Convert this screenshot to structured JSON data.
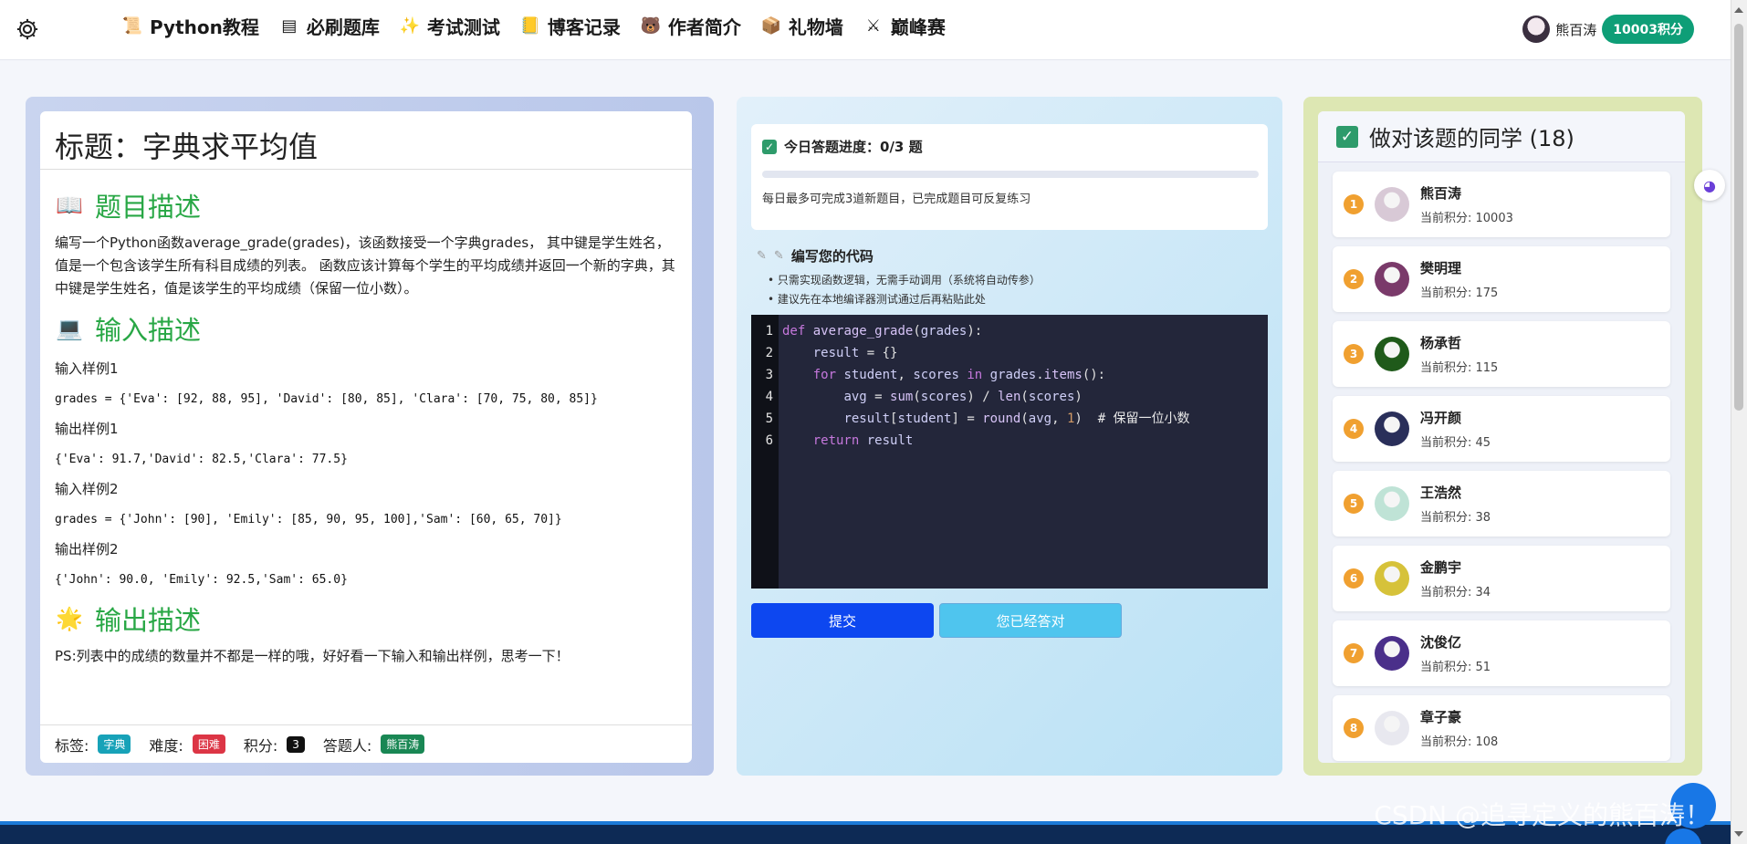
{
  "nav": {
    "items": [
      {
        "icon": "📜",
        "label": "Python教程"
      },
      {
        "icon": "▤",
        "label": "必刷题库"
      },
      {
        "icon": "✨",
        "label": "考试测试"
      },
      {
        "icon": "📒",
        "label": "博客记录"
      },
      {
        "icon": "🐻",
        "label": "作者简介"
      },
      {
        "icon": "📦",
        "label": "礼物墙"
      },
      {
        "icon": "⚔",
        "label": "巅峰赛"
      }
    ],
    "user_name": "熊百涛",
    "points": "10003积分"
  },
  "question": {
    "title": "标题：字典求平均值",
    "desc_heading": "题目描述",
    "desc_text": "编写一个Python函数average_grade(grades)，该函数接受一个字典grades， 其中键是学生姓名，值是一个包含该学生所有科目成绩的列表。 函数应该计算每个学生的平均成绩并返回一个新的字典，其中键是学生姓名，值是该学生的平均成绩（保留一位小数）。",
    "input_heading": "输入描述",
    "examples": [
      {
        "label": "输入样例1",
        "code": "grades = {'Eva': [92, 88, 95], 'David': [80, 85], 'Clara': [70, 75, 80, 85]}"
      },
      {
        "label": "输出样例1",
        "code": "{'Eva': 91.7,'David': 82.5,'Clara': 77.5}"
      },
      {
        "label": "输入样例2",
        "code": "grades = {'John': [90], 'Emily': [85, 90, 95, 100],'Sam': [60, 65, 70]}"
      },
      {
        "label": "输出样例2",
        "code": "{'John': 90.0, 'Emily': 92.5,'Sam': 65.0}"
      }
    ],
    "output_heading": "输出描述",
    "output_text": "PS:列表中的成绩的数量并不都是一样的哦，好好看一下输入和输出样例，思考一下！",
    "tags_label": "标签:",
    "tag": "字典",
    "difficulty_label": "难度:",
    "difficulty": "困难",
    "score_label": "积分:",
    "score": "3",
    "solver_label": "答题人:",
    "solver": "熊百涛"
  },
  "progress": {
    "title": "今日答题进度：0/3 题",
    "done": 0,
    "total": 3,
    "note": "每日最多可完成3道新题目，已完成题目可反复练习"
  },
  "editor": {
    "heading": "编写您的代码",
    "tips": [
      "• 只需实现函数逻辑，无需手动调用（系统将自动传参）",
      "• 建议先在本地编译器测试通过后再粘贴此处"
    ],
    "line_numbers": [
      "1",
      "2",
      "3",
      "4",
      "5",
      "6"
    ],
    "submit_label": "提交",
    "done_label": "您已经答对"
  },
  "ranking": {
    "heading": "做对该题的同学 (18)",
    "score_prefix": "当前积分: ",
    "people": [
      {
        "rank": "1",
        "name": "熊百涛",
        "score": "当前积分: 10003",
        "avatar_color": "#d8c9d6"
      },
      {
        "rank": "2",
        "name": "樊明理",
        "score": "当前积分: 175",
        "avatar_color": "#7a3a6a"
      },
      {
        "rank": "3",
        "name": "杨承哲",
        "score": "当前积分: 115",
        "avatar_color": "#1f5a1a"
      },
      {
        "rank": "4",
        "name": "冯开颜",
        "score": "当前积分: 45",
        "avatar_color": "#2a2f5a"
      },
      {
        "rank": "5",
        "name": "王浩然",
        "score": "当前积分: 38",
        "avatar_color": "#bfe3d6"
      },
      {
        "rank": "6",
        "name": "金鹏宇",
        "score": "当前积分: 34",
        "avatar_color": "#d6c23a"
      },
      {
        "rank": "7",
        "name": "沈俊亿",
        "score": "当前积分: 51",
        "avatar_color": "#4a2f8a"
      },
      {
        "rank": "8",
        "name": "章子豪",
        "score": "当前积分: 108",
        "avatar_color": "#e8e8ef"
      }
    ]
  },
  "watermark": "CSDN @追寻定义的熊百涛！"
}
